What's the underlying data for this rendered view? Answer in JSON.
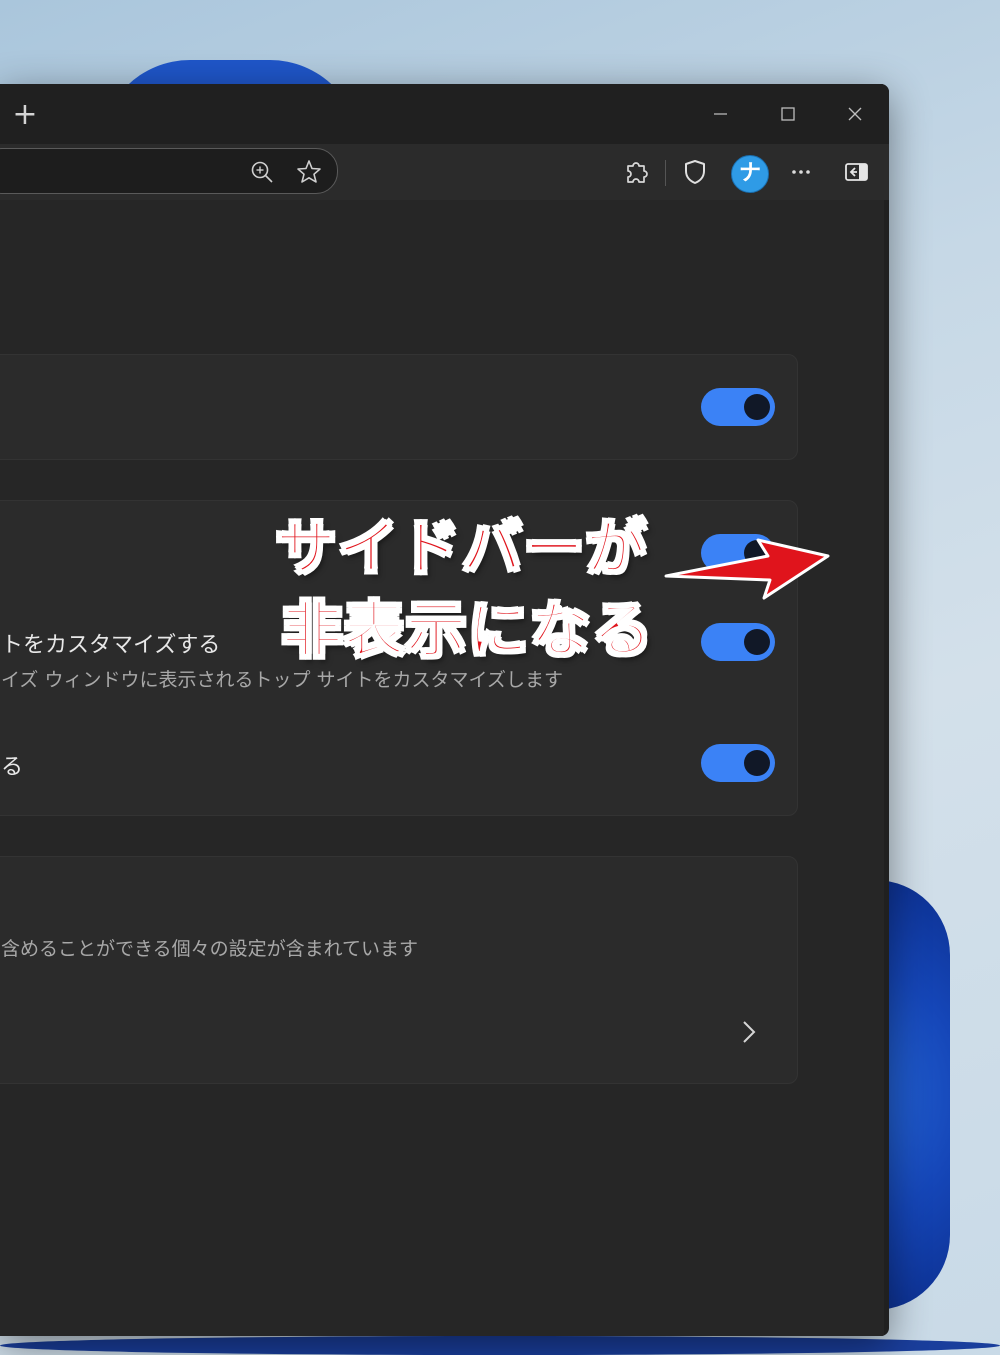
{
  "browser": {
    "new_tab_label": "+",
    "profile_initial": "ナ"
  },
  "settings": {
    "row_customize_title": "トをカスタマイズする",
    "row_customize_desc": "イズ ウィンドウに表示されるトップ サイトをカスタマイズします",
    "row_third_title": "る",
    "card3_desc": "含めることができる個々の設定が含まれています"
  },
  "toggles": [
    {
      "id": "toggle-1",
      "on": true
    },
    {
      "id": "toggle-2",
      "on": true
    },
    {
      "id": "toggle-3",
      "on": true
    },
    {
      "id": "toggle-4",
      "on": true
    }
  ],
  "annotation": {
    "line1": "サイドバーが",
    "line2": "非表示になる",
    "color": "#e0141c"
  },
  "colors": {
    "accent": "#3b82f6",
    "window_bg": "#202020",
    "card_bg": "#2b2b2b"
  }
}
